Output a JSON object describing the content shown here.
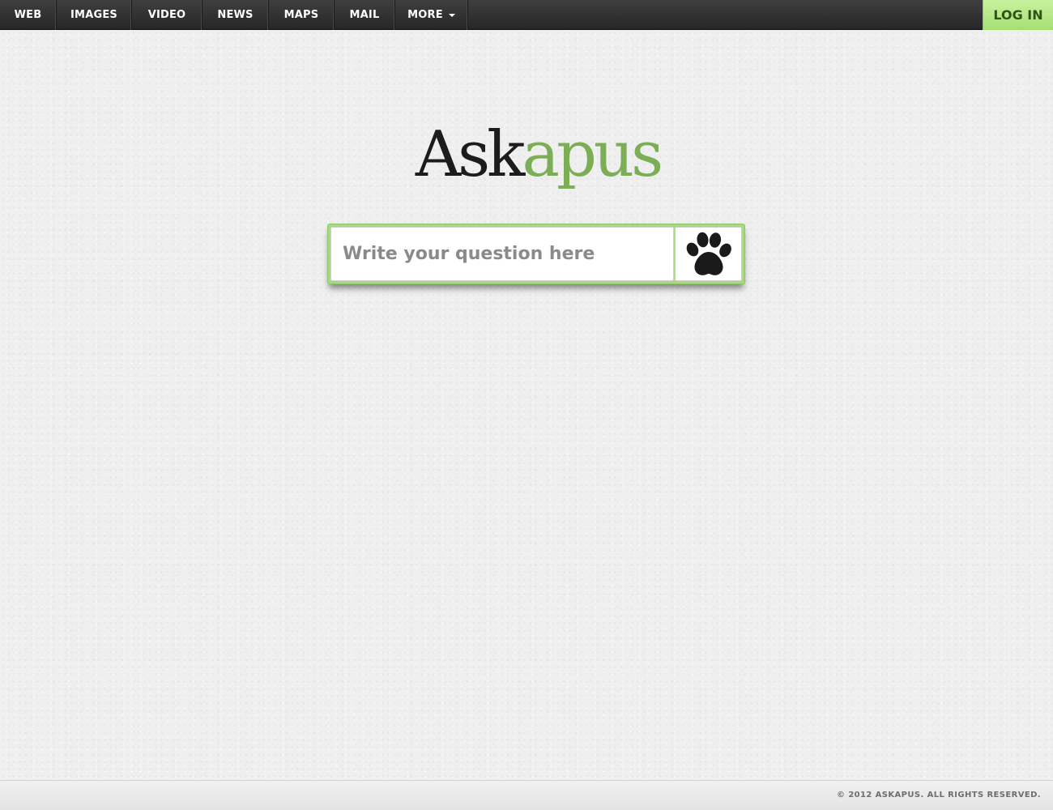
{
  "nav": {
    "items": [
      {
        "label": "WEB"
      },
      {
        "label": "IMAGES"
      },
      {
        "label": "VIDEO"
      },
      {
        "label": "NEWS"
      },
      {
        "label": "MAPS"
      },
      {
        "label": "MAIL"
      },
      {
        "label": "MORE",
        "icon": "chevron-down-icon"
      }
    ],
    "login_label": "LOG IN"
  },
  "logo": {
    "part1": "Ask",
    "part2": "apus"
  },
  "search": {
    "placeholder": "Write your question here",
    "value": "",
    "button_icon": "paw-icon"
  },
  "footer": {
    "copyright": "© 2012 ASKAPUS. ALL RIGHTS RESERVED."
  },
  "colors": {
    "brand_green": "#7bae55",
    "login_bg": "#b6e98b",
    "nav_bg": "#2f2f2f",
    "page_bg": "#efefef"
  }
}
